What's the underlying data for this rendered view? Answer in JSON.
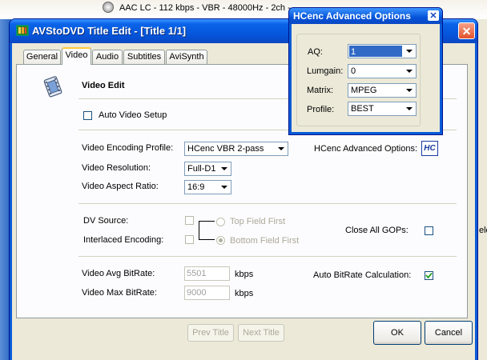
{
  "background": {
    "top_text": "AAC LC - 112 kbps - VBR - 48000Hz - 2ch -",
    "right_fragment": "ele"
  },
  "window": {
    "title": "AVStoDVD Title Edit - [Title 1/1]",
    "close_symbol": "✕"
  },
  "tabs": [
    {
      "label": "General"
    },
    {
      "label": "Video"
    },
    {
      "label": "Audio"
    },
    {
      "label": "Subtitles"
    },
    {
      "label": "AviSynth"
    }
  ],
  "video": {
    "section_title": "Video Edit",
    "auto_setup_label": "Auto Video Setup",
    "encoding_profile_label": "Video Encoding Profile:",
    "encoding_profile_value": "HCenc VBR 2-pass",
    "resolution_label": "Video Resolution:",
    "resolution_value": "Full-D1",
    "aspect_label": "Video Aspect Ratio:",
    "aspect_value": "16:9",
    "hcenc_options_label": "HCenc Advanced Options:",
    "hcenc_icon_text": "HC",
    "dv_source_label": "DV Source:",
    "interlaced_label": "Interlaced Encoding:",
    "top_field_label": "Top Field First",
    "bottom_field_label": "Bottom Field First",
    "close_gops_label": "Close All GOPs:",
    "avg_bitrate_label": "Video Avg BitRate:",
    "avg_bitrate_value": "5501",
    "max_bitrate_label": "Video Max BitRate:",
    "max_bitrate_value": "9000",
    "kbps_unit": "kbps",
    "auto_bitrate_label": "Auto BitRate Calculation:"
  },
  "buttons": {
    "prev": "Prev Title",
    "next": "Next Title",
    "ok": "OK",
    "cancel": "Cancel"
  },
  "hcenc": {
    "title": "HCenc Advanced Options",
    "close_symbol": "✕",
    "aq_label": "AQ:",
    "aq_value": "1",
    "lumgain_label": "Lumgain:",
    "lumgain_value": "0",
    "matrix_label": "Matrix:",
    "matrix_value": "MPEG",
    "profile_label": "Profile:",
    "profile_value": "BEST"
  },
  "colors": {
    "titlebar": "#0a5bd8",
    "tab_highlight": "#ffc83c",
    "selection": "#316ac5"
  }
}
